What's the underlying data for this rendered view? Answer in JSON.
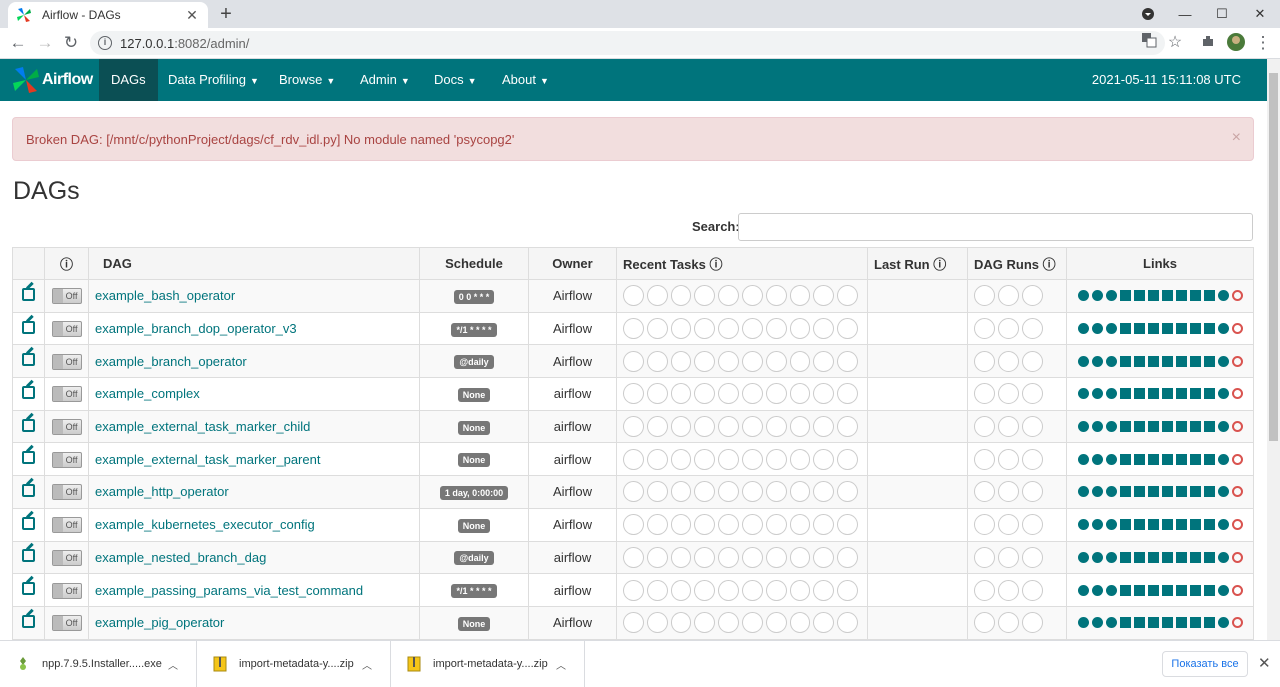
{
  "browser": {
    "tab_title": "Airflow - DAGs",
    "tab_close": "✕",
    "new_tab": "+",
    "url_host": "127.0.0.1",
    "url_rest": ":8082/admin/",
    "controls": {
      "minimize": "—",
      "maximize": "☐",
      "close": "✕"
    }
  },
  "navbar": {
    "brand": "Airflow",
    "items": [
      {
        "label": "DAGs",
        "active": true
      },
      {
        "label": "Data Profiling"
      },
      {
        "label": "Browse"
      },
      {
        "label": "Admin"
      },
      {
        "label": "Docs"
      },
      {
        "label": "About"
      }
    ],
    "time": "2021-05-11 15:11:08 UTC"
  },
  "alert": {
    "message": "Broken DAG: [/mnt/c/pythonProject/dags/cf_rdv_idl.py] No module named 'psycopg2'",
    "close": "×"
  },
  "page_title": "DAGs",
  "search": {
    "label": "Search:",
    "value": ""
  },
  "table": {
    "headers": {
      "info": "ⓘ",
      "dag": "DAG",
      "schedule": "Schedule",
      "owner": "Owner",
      "recent_tasks": "Recent Tasks",
      "last_run": "Last Run",
      "dag_runs": "DAG Runs",
      "links": "Links"
    },
    "rows": [
      {
        "toggle": "Off",
        "dag": "example_bash_operator",
        "schedule": "0 0 * * *",
        "owner": "Airflow"
      },
      {
        "toggle": "Off",
        "dag": "example_branch_dop_operator_v3",
        "schedule": "*/1 * * * *",
        "owner": "Airflow"
      },
      {
        "toggle": "Off",
        "dag": "example_branch_operator",
        "schedule": "@daily",
        "owner": "Airflow"
      },
      {
        "toggle": "Off",
        "dag": "example_complex",
        "schedule": "None",
        "owner": "airflow"
      },
      {
        "toggle": "Off",
        "dag": "example_external_task_marker_child",
        "schedule": "None",
        "owner": "airflow"
      },
      {
        "toggle": "Off",
        "dag": "example_external_task_marker_parent",
        "schedule": "None",
        "owner": "airflow"
      },
      {
        "toggle": "Off",
        "dag": "example_http_operator",
        "schedule": "1 day, 0:00:00",
        "owner": "Airflow"
      },
      {
        "toggle": "Off",
        "dag": "example_kubernetes_executor_config",
        "schedule": "None",
        "owner": "Airflow"
      },
      {
        "toggle": "Off",
        "dag": "example_nested_branch_dag",
        "schedule": "@daily",
        "owner": "airflow"
      },
      {
        "toggle": "Off",
        "dag": "example_passing_params_via_test_command",
        "schedule": "*/1 * * * *",
        "owner": "airflow"
      },
      {
        "toggle": "Off",
        "dag": "example_pig_operator",
        "schedule": "None",
        "owner": "Airflow"
      }
    ]
  },
  "downloads": {
    "items": [
      {
        "name": "npp.7.9.5.Installer.....exe"
      },
      {
        "name": "import-metadata-y....zip"
      },
      {
        "name": "import-metadata-y....zip"
      }
    ],
    "show_all": "Показать все",
    "close": "✕"
  },
  "colors": {
    "accent": "#00747c",
    "danger": "#d9534f"
  }
}
